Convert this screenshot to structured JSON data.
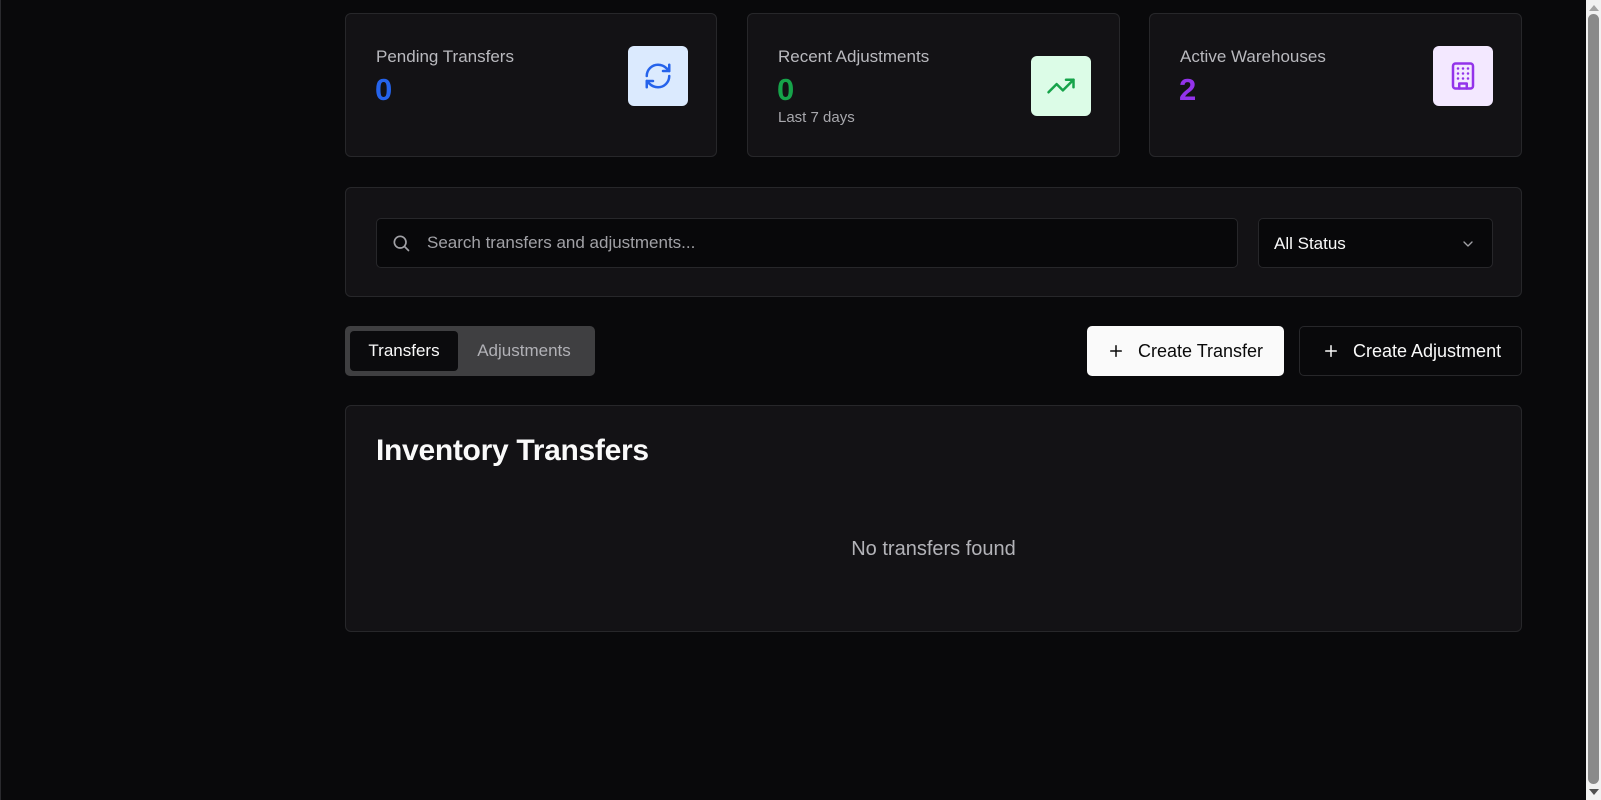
{
  "stats": [
    {
      "label": "Pending Transfers",
      "value": "0",
      "sub": "",
      "icon": "refresh-icon",
      "value_color": "#2563eb",
      "icon_bg": "#dbeafe",
      "icon_color": "#2563eb"
    },
    {
      "label": "Recent Adjustments",
      "value": "0",
      "sub": "Last 7 days",
      "icon": "trending-up-icon",
      "value_color": "#16a34a",
      "icon_bg": "#dcfce7",
      "icon_color": "#16a34a"
    },
    {
      "label": "Active Warehouses",
      "value": "2",
      "sub": "",
      "icon": "building-icon",
      "value_color": "#9333ea",
      "icon_bg": "#f3e8ff",
      "icon_color": "#9333ea"
    }
  ],
  "filters": {
    "search_placeholder": "Search transfers and adjustments...",
    "search_value": "",
    "status_selected": "All Status"
  },
  "tabs": [
    {
      "label": "Transfers",
      "active": true
    },
    {
      "label": "Adjustments",
      "active": false
    }
  ],
  "actions": {
    "create_transfer": "Create Transfer",
    "create_adjustment": "Create Adjustment"
  },
  "panel": {
    "title": "Inventory Transfers",
    "empty_message": "No transfers found"
  }
}
